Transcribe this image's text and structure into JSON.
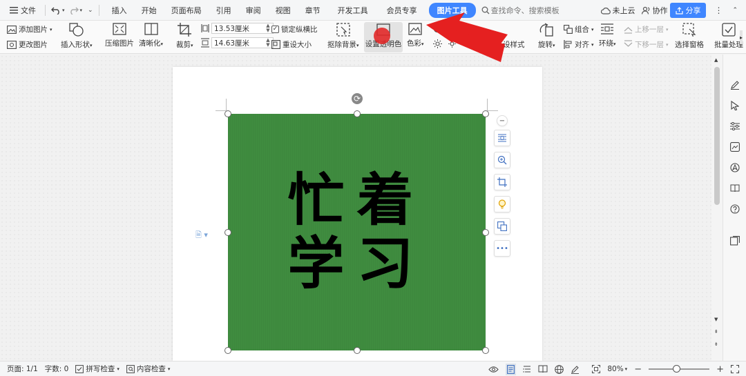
{
  "menubar": {
    "file": "文件",
    "tabs": [
      "插入",
      "开始",
      "页面布局",
      "引用",
      "审阅",
      "视图",
      "章节",
      "开发工具",
      "会员专享"
    ],
    "active_tab": "图片工具",
    "search": "查找命令、搜索模板",
    "cloud": "未上云",
    "collab": "协作",
    "share": "分享"
  },
  "ribbon": {
    "add_picture": "添加图片",
    "change_picture": "更改图片",
    "insert_shape": "插入形状",
    "compress_picture": "压缩图片",
    "sharpen": "清晰化",
    "crop": "裁剪",
    "width_value": "13.53厘米",
    "height_value": "14.63厘米",
    "lock_ratio": "锁定纵横比",
    "reset_size": "重设大小",
    "remove_background": "抠除背景",
    "set_transparent": "设置透明色",
    "color": "色彩",
    "style_partial": "设样式",
    "rotate": "旋转",
    "group": "组合",
    "align": "对齐",
    "wrap": "环绕",
    "bring_forward": "上移一层",
    "send_backward": "下移一层",
    "selection_pane": "选择窗格",
    "batch_process": "批量处理"
  },
  "image": {
    "line1": "忙着",
    "line2": "学习",
    "fill_color": "#3f8c3f"
  },
  "statusbar": {
    "page": "页面: 1/1",
    "word_count": "字数: 0",
    "spell_check": "拼写检查",
    "content_check": "内容检查",
    "zoom": "80%",
    "zoom_level": 0.8
  },
  "colors": {
    "accent": "#3f86ff",
    "arrow": "#e52020"
  }
}
